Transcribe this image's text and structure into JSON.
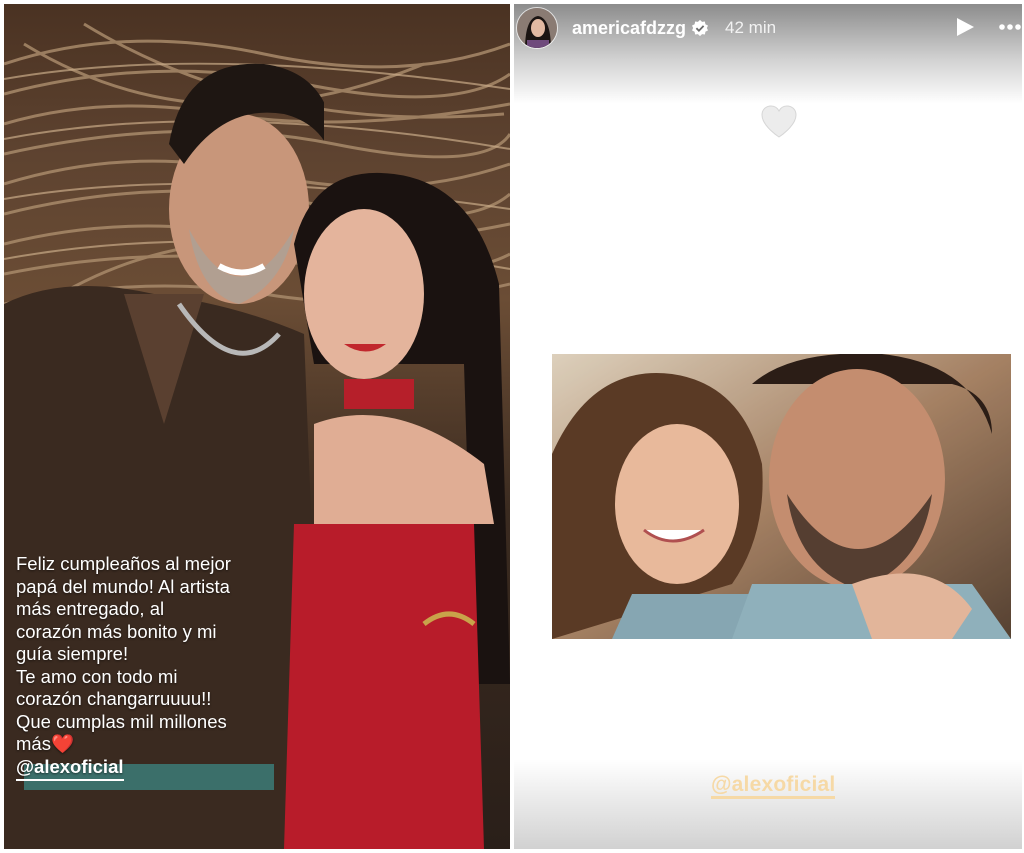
{
  "left_story": {
    "caption_lines": [
      "Feliz cumpleaños al mejor",
      "papá del mundo! Al artista",
      "más entregado, al",
      "corazón más bonito y mi",
      "guía siempre!",
      "Te amo con todo mi",
      "corazón changarruuuu!!",
      "Que cumplas mil millones",
      "más❤️"
    ],
    "mention": "@alexoficial"
  },
  "right_story": {
    "header": {
      "username": "americafdzzg",
      "time": "42 min",
      "verified_icon": "verified-badge-icon",
      "play_icon": "play-icon",
      "more_icon": "more-options-icon"
    },
    "sticker_icon": "white-heart-icon",
    "mention": "@alexoficial",
    "colors": {
      "mention": "#f6d9a6",
      "header_text": "#ffffff"
    }
  }
}
